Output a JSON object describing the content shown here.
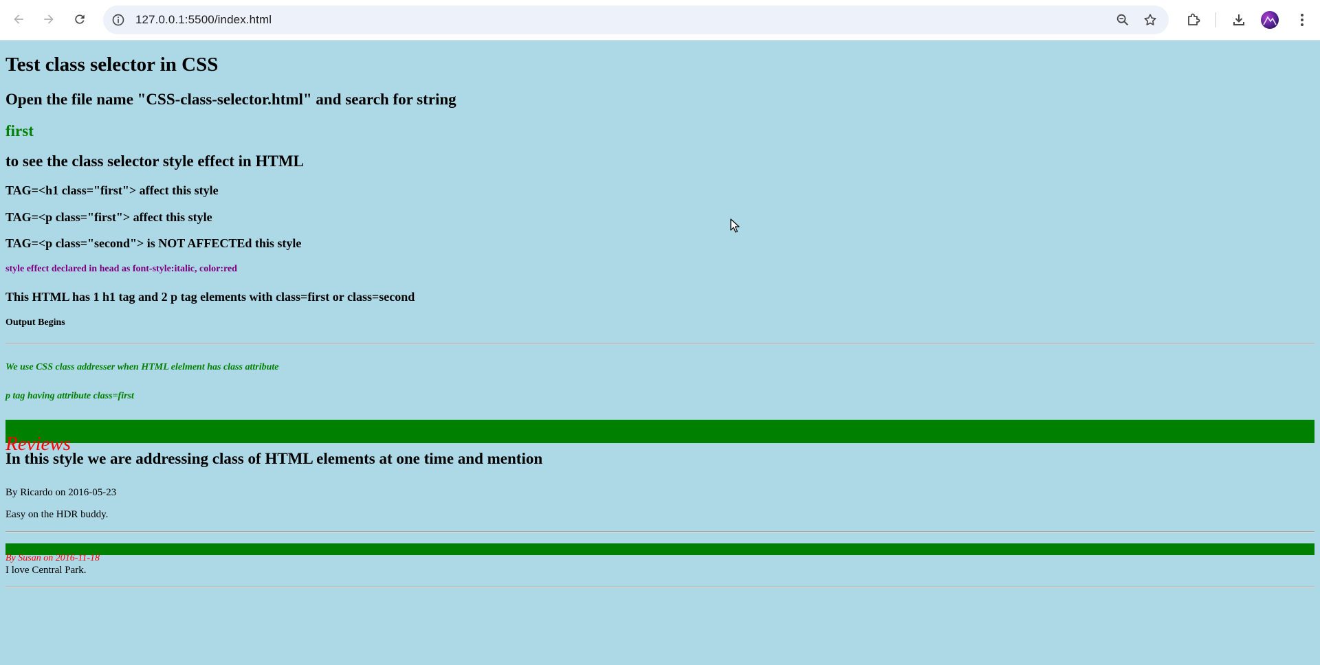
{
  "browser": {
    "url": "127.0.0.1:5500/index.html"
  },
  "content": {
    "title": "Test class selector in CSS",
    "instruction": "Open the file name \"CSS-class-selector.html\" and search for string",
    "search_string": "first",
    "instruction_2": "to see the class selector style effect in HTML",
    "tag_h1": "TAG=<h1 class=\"first\"> affect this style",
    "tag_p_first": "TAG=<p class=\"first\"> affect this style",
    "tag_p_second": "TAG=<p class=\"second\"> is NOT AFFECTEd this style",
    "style_note": "style effect declared in head as font-style:italic, color:red",
    "summary": "This HTML has 1 h1 tag and 2 p tag elements with class=first or class=second",
    "output_begins": "Output Begins",
    "output_line_1": "We use CSS class addresser when HTML elelment has class attribute",
    "output_line_2": "p tag having attribute class=first",
    "reviews_heading": "Reviews",
    "addressing_heading": "In this style we are addressing class of HTML elements at one time and mention",
    "review_1_by": "By Ricardo on 2016-05-23",
    "review_1_text": "Easy on the HDR buddy.",
    "review_2_by": "By Susan on 2016-11-18",
    "review_2_text": "I love Central Park."
  },
  "colors": {
    "page_background": "#add8e6",
    "green": "#008000",
    "red": "#ff0000",
    "purple": "#800080"
  }
}
